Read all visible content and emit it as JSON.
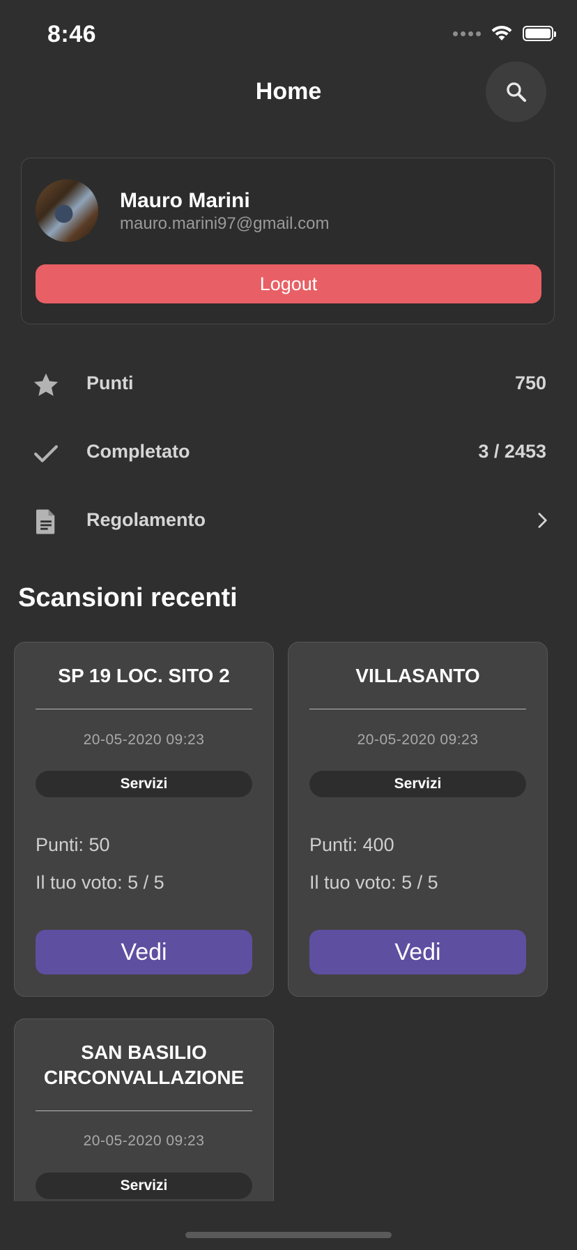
{
  "status_bar": {
    "time": "8:46"
  },
  "header": {
    "title": "Home"
  },
  "profile": {
    "name": "Mauro Marini",
    "email": "mauro.marini97@gmail.com",
    "logout_label": "Logout"
  },
  "stats": [
    {
      "label": "Punti",
      "value": "750",
      "icon": "star-icon"
    },
    {
      "label": "Completato",
      "value": "3 / 2453",
      "icon": "check-icon"
    },
    {
      "label": "Regolamento",
      "value": "",
      "icon": "document-icon"
    }
  ],
  "recent": {
    "title": "Scansioni recenti",
    "items": [
      {
        "name": "SP 19 LOC. SITO 2",
        "date": "20-05-2020 09:23",
        "tag": "Servizi",
        "points": "Punti: 50",
        "vote": "Il tuo voto: 5 / 5",
        "button": "Vedi"
      },
      {
        "name": "VILLASANTO",
        "date": "20-05-2020 09:23",
        "tag": "Servizi",
        "points": "Punti: 400",
        "vote": "Il tuo voto: 5 / 5",
        "button": "Vedi"
      },
      {
        "name_line1": "SAN BASILIO",
        "name_line2": "CIRCONVALLAZIONE",
        "date": "20-05-2020 09:23",
        "tag": "Servizi"
      }
    ]
  },
  "colors": {
    "background": "#2f2f2f",
    "logout": "#e86065",
    "button_primary": "#5e4fa0",
    "card": "#424242"
  }
}
